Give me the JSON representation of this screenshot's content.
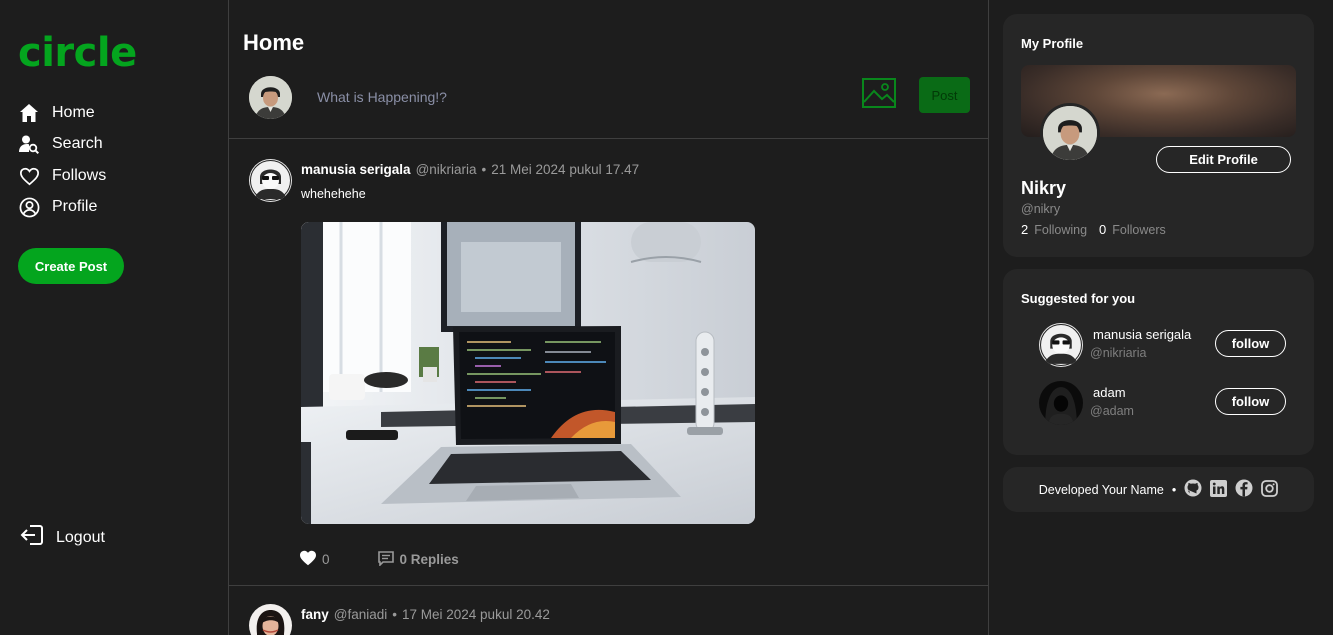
{
  "app": {
    "logo": "circle"
  },
  "nav": {
    "items": [
      {
        "label": "Home",
        "icon": "home-icon"
      },
      {
        "label": "Search",
        "icon": "search-user-icon"
      },
      {
        "label": "Follows",
        "icon": "heart-icon"
      },
      {
        "label": "Profile",
        "icon": "user-circle-icon"
      }
    ],
    "create_post": "Create Post",
    "logout": "Logout"
  },
  "main": {
    "title": "Home",
    "composer": {
      "placeholder": "What is Happening!?",
      "post_label": "Post"
    },
    "posts": [
      {
        "name": "manusia serigala",
        "handle": "@nikriaria",
        "dot": "•",
        "date": "21 Mei 2024 pukul 17.47",
        "text": "whehehehe",
        "likes": "0",
        "replies": "0 Replies"
      },
      {
        "name": "fany",
        "handle": "@faniadi",
        "dot": "•",
        "date": "17 Mei 2024 pukul 20.42"
      }
    ]
  },
  "profile": {
    "title": "My Profile",
    "edit": "Edit Profile",
    "name": "Nikry",
    "handle": "@nikry",
    "following_count": "2",
    "following_label": "Following",
    "followers_count": "0",
    "followers_label": "Followers"
  },
  "suggested": {
    "title": "Suggested for you",
    "users": [
      {
        "name": "manusia serigala",
        "handle": "@nikriaria",
        "button": "follow"
      },
      {
        "name": "adam",
        "handle": "@adam",
        "button": "follow"
      }
    ]
  },
  "footer": {
    "text": "Developed Your Name",
    "dot": "•",
    "icons": [
      "github-icon",
      "linkedin-icon",
      "facebook-icon",
      "instagram-icon"
    ]
  },
  "colors": {
    "accent": "#04a51e",
    "background": "#1d1d1d",
    "card": "#262626"
  }
}
